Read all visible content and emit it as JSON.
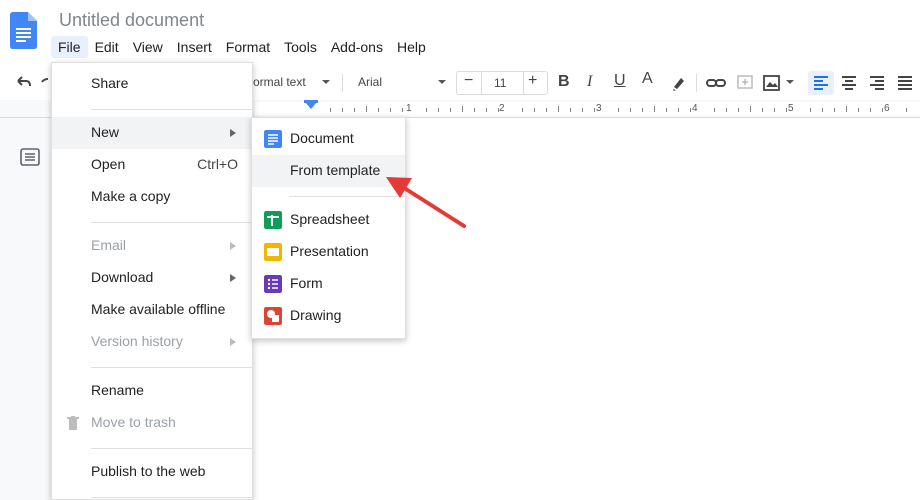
{
  "app": {
    "doc_title": "Untitled document",
    "logo_icon": "google-docs-icon"
  },
  "menubar": {
    "items": [
      "File",
      "Edit",
      "View",
      "Insert",
      "Format",
      "Tools",
      "Add-ons",
      "Help"
    ],
    "active": "File"
  },
  "toolbar": {
    "style_label": "ormal text",
    "font_label": "Arial",
    "minus_label": "−",
    "font_size": "11",
    "plus_label": "+",
    "bold_label": "B",
    "italic_label": "I",
    "underline_label": "U",
    "text_color_label": "A",
    "icons": [
      "undo-icon",
      "redo-icon",
      "highlight-icon",
      "link-icon",
      "comment-icon",
      "image-icon",
      "align-left-icon",
      "align-center-icon",
      "align-right-icon",
      "justify-icon"
    ]
  },
  "ruler": {
    "numbers": [
      "1",
      "2",
      "3",
      "4",
      "5",
      "6"
    ]
  },
  "file_menu": {
    "share": "Share",
    "new": "New",
    "open": "Open",
    "open_shortcut": "Ctrl+O",
    "make_copy": "Make a copy",
    "email": "Email",
    "download": "Download",
    "make_offline": "Make available offline",
    "version_history": "Version history",
    "rename": "Rename",
    "move_to_trash": "Move to trash",
    "publish": "Publish to the web"
  },
  "new_submenu": {
    "document": "Document",
    "from_template": "From template",
    "spreadsheet": "Spreadsheet",
    "presentation": "Presentation",
    "form": "Form",
    "drawing": "Drawing"
  },
  "colors": {
    "docs_blue": "#4285f4",
    "sheets_green": "#0f9d58",
    "slides_yellow": "#f4b400",
    "forms_purple": "#673ab7",
    "drawings_red": "#db4437",
    "annotation_arrow": "#e53935"
  }
}
